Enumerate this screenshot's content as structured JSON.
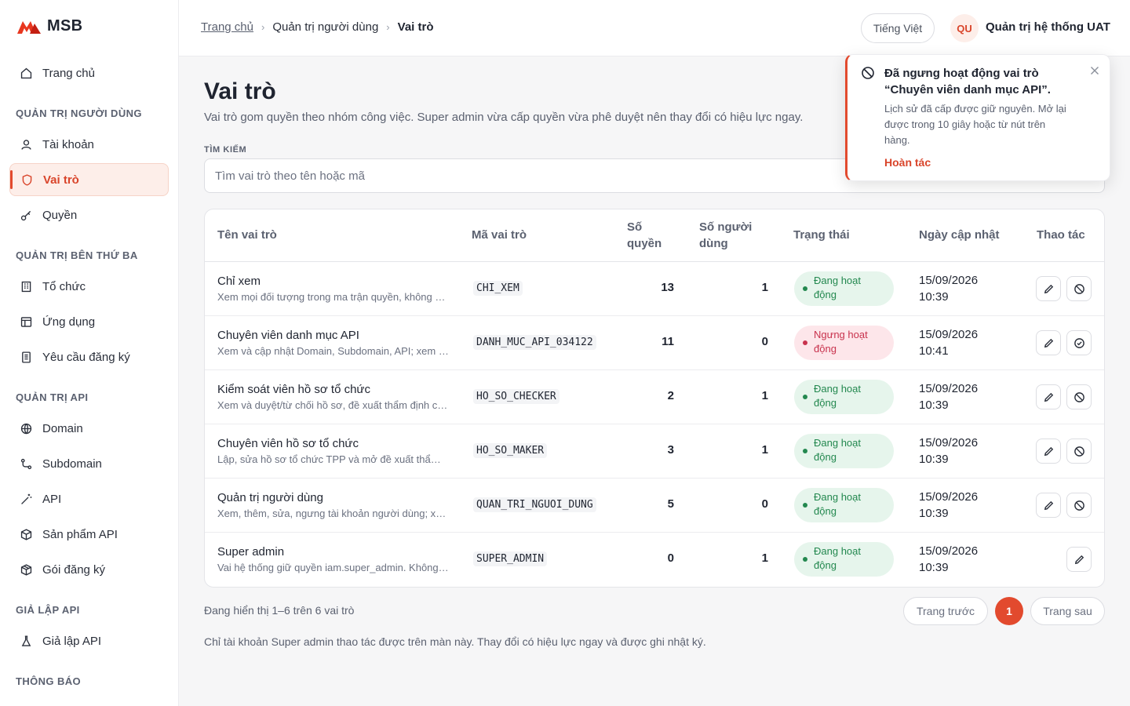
{
  "brand": {
    "logo_text": "MSB",
    "accent": "#e24a2e"
  },
  "sidebar": {
    "home": "Trang chủ",
    "sections": {
      "users": "QUẢN TRỊ NGƯỜI DÙNG",
      "third_party": "QUẢN TRỊ BÊN THỨ BA",
      "api": "QUẢN TRỊ API",
      "sim": "GIẢ LẬP API",
      "notify": "THÔNG BÁO"
    },
    "items": {
      "accounts": "Tài khoản",
      "roles": "Vai trò",
      "permissions": "Quyền",
      "orgs": "Tổ chức",
      "apps": "Ứng dụng",
      "requests": "Yêu cầu đăng ký",
      "domain": "Domain",
      "subdomain": "Subdomain",
      "api": "API",
      "api_products": "Sản phẩm API",
      "subscriptions": "Gói đăng ký",
      "api_sim": "Giả lập API"
    }
  },
  "header": {
    "breadcrumb": [
      "Trang chủ",
      "Quản trị người dùng",
      "Vai trò"
    ],
    "language": "Tiếng Việt",
    "avatar_initials": "QU",
    "user_name": "Quản trị hệ thống UAT"
  },
  "page": {
    "title": "Vai trò",
    "description": "Vai trò gom quyền theo nhóm công việc. Super admin vừa cấp quyền vừa phê duyệt nên thay đổi có hiệu lực ngay.",
    "search_label": "TÌM KIẾM",
    "search_placeholder": "Tìm vai trò theo tên hoặc mã"
  },
  "table": {
    "headers": {
      "name": "Tên vai trò",
      "code": "Mã vai trò",
      "perm_line1": "Số",
      "perm_line2": "quyền",
      "users_line1": "Số người",
      "users_line2": "dùng",
      "status": "Trạng thái",
      "updated": "Ngày cập nhật",
      "actions": "Thao tác"
    },
    "rows": [
      {
        "name": "Chỉ xem",
        "desc": "Xem mọi đối tượng trong ma trận quyền, không sửa được gì.",
        "code": "CHI_XEM",
        "perms": "13",
        "users": "1",
        "status_l1": "Đang hoạt",
        "status_l2": "động",
        "status_kind": "active",
        "date": "15/09/2026",
        "time": "10:39"
      },
      {
        "name": "Chuyên viên danh mục API",
        "desc": "Xem và cập nhật Domain, Subdomain, API; xem sản phẩm API.",
        "code": "DANH_MUC_API_034122",
        "perms": "11",
        "users": "0",
        "status_l1": "Ngưng hoạt",
        "status_l2": "động",
        "status_kind": "inactive",
        "date": "15/09/2026",
        "time": "10:41"
      },
      {
        "name": "Kiểm soát viên hồ sơ tổ chức",
        "desc": "Xem và duyệt/từ chối hồ sơ, đề xuất thẩm định cấp quyền.",
        "code": "HO_SO_CHECKER",
        "perms": "2",
        "users": "1",
        "status_l1": "Đang hoạt",
        "status_l2": "động",
        "status_kind": "active",
        "date": "15/09/2026",
        "time": "10:39"
      },
      {
        "name": "Chuyên viên hồ sơ tổ chức",
        "desc": "Lập, sửa hồ sơ tổ chức TPP và mở đề xuất thẩm định.",
        "code": "HO_SO_MAKER",
        "perms": "3",
        "users": "1",
        "status_l1": "Đang hoạt",
        "status_l2": "động",
        "status_kind": "active",
        "date": "15/09/2026",
        "time": "10:39"
      },
      {
        "name": "Quản trị người dùng",
        "desc": "Xem, thêm, sửa, ngưng tài khoản người dùng; xem vai trò.",
        "code": "QUAN_TRI_NGUOI_DUNG",
        "perms": "5",
        "users": "0",
        "status_l1": "Đang hoạt",
        "status_l2": "động",
        "status_kind": "active",
        "date": "15/09/2026",
        "time": "10:39"
      },
      {
        "name": "Super admin",
        "desc": "Vai hệ thống giữ quyền iam.super_admin. Không thể ngưng.",
        "code": "SUPER_ADMIN",
        "perms": "0",
        "users": "1",
        "status_l1": "Đang hoạt",
        "status_l2": "động",
        "status_kind": "active",
        "date": "15/09/2026",
        "time": "10:39"
      }
    ]
  },
  "pagination": {
    "summary": "Đang hiển thị 1–6 trên 6 vai trò",
    "prev": "Trang trước",
    "current": "1",
    "next": "Trang sau"
  },
  "footer_note": "Chỉ tài khoản Super admin thao tác được trên màn này. Thay đổi có hiệu lực ngay và được ghi nhật ký.",
  "toast": {
    "title": "Đã ngưng hoạt động vai trò “Chuyên viên danh mục API”.",
    "body": "Lịch sử đã cấp được giữ nguyên. Mở lại được trong 10 giây hoặc từ nút trên hàng.",
    "undo": "Hoàn tác"
  }
}
